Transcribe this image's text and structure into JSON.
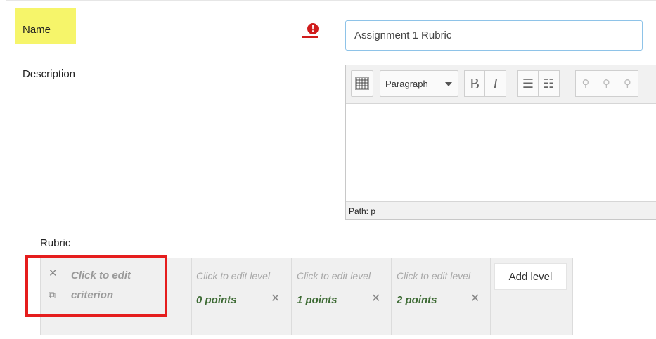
{
  "name_field": {
    "label": "Name",
    "required_icon": "exclamation-icon",
    "value": "Assignment 1 Rubric"
  },
  "description": {
    "label": "Description",
    "toolbar": {
      "format_select": "Paragraph",
      "bold": "B",
      "italic": "I",
      "bullet_list": "☰",
      "numbered_list": "☷",
      "link": "⚲",
      "unlink": "⚲",
      "extra": "⚲"
    },
    "path": "Path: p"
  },
  "rubric": {
    "label": "Rubric",
    "criterion": {
      "delete_icon": "✕",
      "duplicate_icon": "⧉",
      "line1": "Click to edit",
      "line2": "criterion"
    },
    "levels": [
      {
        "definition": "Click to edit level",
        "points": "0 points",
        "delete_icon": "✕"
      },
      {
        "definition": "Click to edit level",
        "points": "1 points",
        "delete_icon": "✕"
      },
      {
        "definition": "Click to edit level",
        "points": "2 points",
        "delete_icon": "✕"
      }
    ],
    "add_level_label": "Add level"
  },
  "colors": {
    "name_highlight": "#f6f56a",
    "required_red": "#d01c1c",
    "annotation_red": "#e51d1d",
    "points_green": "#3e6b35"
  }
}
